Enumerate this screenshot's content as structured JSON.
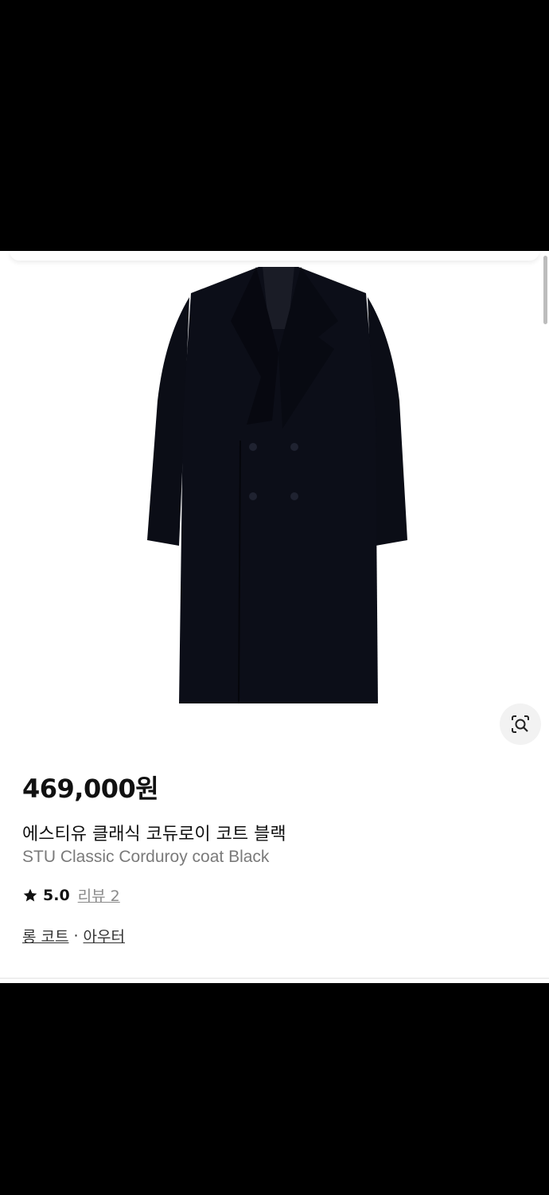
{
  "product": {
    "price": "469,000원",
    "title_ko": "에스티유 클래식 코듀로이 코트 블랙",
    "title_en": "STU Classic Corduroy coat Black",
    "rating": "5.0",
    "review_label": "리뷰 2",
    "categories": [
      "롱 코트",
      "아우터"
    ],
    "category_separator": "·",
    "image_icon": "black-double-breasted-coat"
  },
  "icons": {
    "star": "star-icon",
    "lens": "visual-search-icon"
  },
  "colors": {
    "text_primary": "#111111",
    "text_secondary": "#7a7a7a",
    "coat": "#0b0d16"
  }
}
